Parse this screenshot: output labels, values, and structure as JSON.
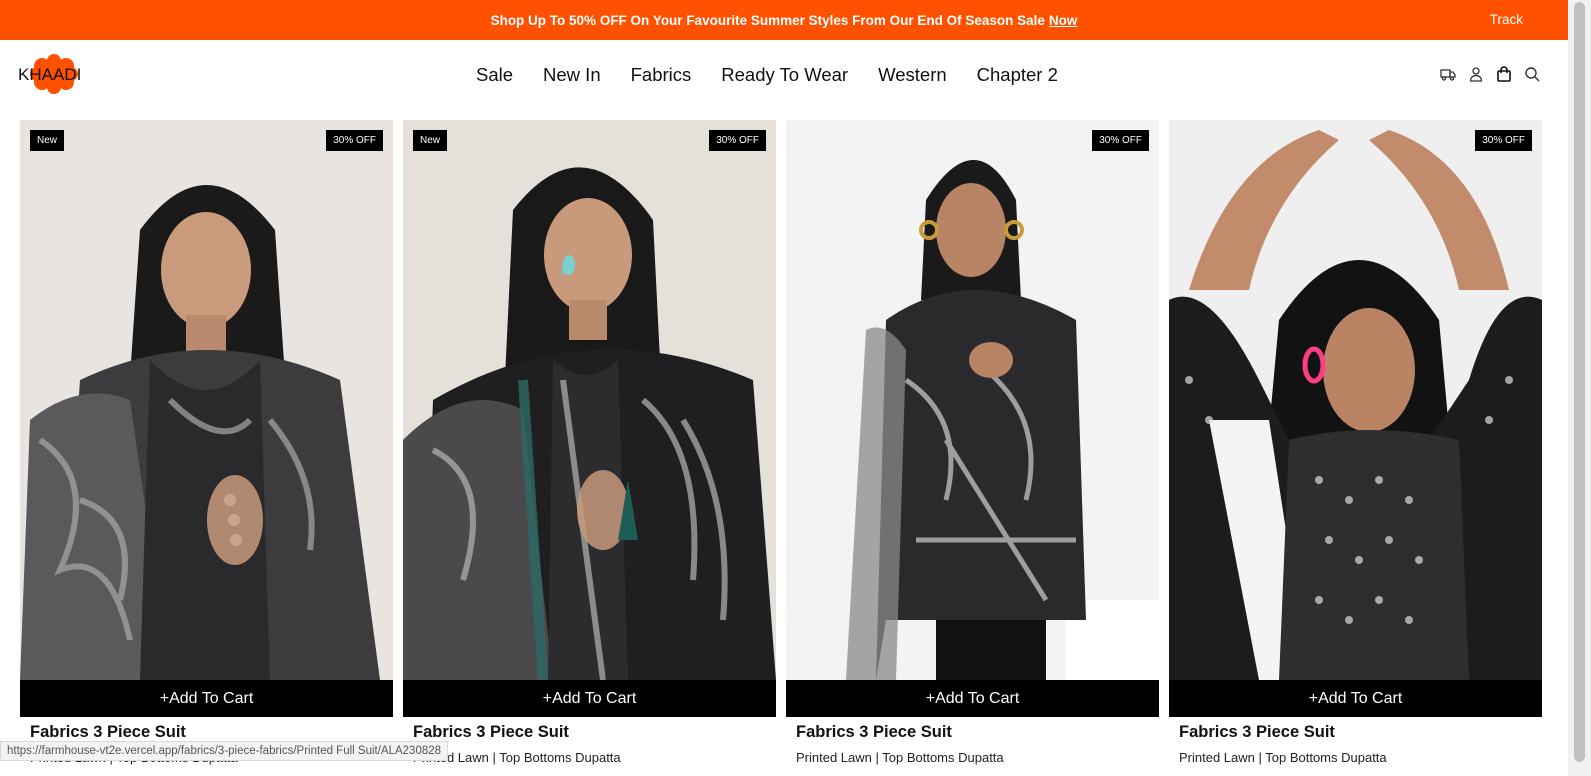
{
  "promo": {
    "text": "Shop Up To 50% OFF On Your Favourite Summer Styles From Our End Of Season Sale",
    "link": "Now",
    "track": "Track"
  },
  "brand": {
    "logo_text": "KHAADI",
    "accent": "#ff5100"
  },
  "nav": [
    {
      "label": "Sale"
    },
    {
      "label": "New In"
    },
    {
      "label": "Fabrics"
    },
    {
      "label": "Ready To Wear"
    },
    {
      "label": "Western"
    },
    {
      "label": "Chapter 2"
    }
  ],
  "header_icons": [
    "truck-icon",
    "user-icon",
    "bag-icon",
    "search-icon"
  ],
  "products": [
    {
      "badge_new": "New",
      "badge_off": "30% OFF",
      "cart": "+Add To Cart",
      "title": "Fabrics 3 Piece Suit",
      "subtitle": "Printed Lawn | Top Bottoms Dupatta"
    },
    {
      "badge_new": "New",
      "badge_off": "30% OFF",
      "cart": "+Add To Cart",
      "title": "Fabrics 3 Piece Suit",
      "subtitle": "Printed Lawn | Top Bottoms Dupatta"
    },
    {
      "badge_new": "",
      "badge_off": "30% OFF",
      "cart": "+Add To Cart",
      "title": "Fabrics 3 Piece Suit",
      "subtitle": "Printed Lawn | Top Bottoms Dupatta"
    },
    {
      "badge_new": "",
      "badge_off": "30% OFF",
      "cart": "+Add To Cart",
      "title": "Fabrics 3 Piece Suit",
      "subtitle": "Printed Lawn | Top Bottoms Dupatta"
    }
  ],
  "status_url": "https://farmhouse-vt2e.vercel.app/fabrics/3-piece-fabrics/Printed Full  Suit/ALA230828"
}
